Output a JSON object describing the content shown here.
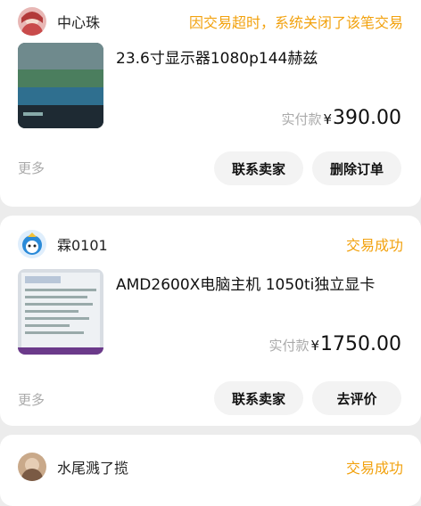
{
  "orders": [
    {
      "seller": "中心珠",
      "status": "因交易超时，系统关闭了该笔交易",
      "title": "23.6寸显示器1080p144赫兹",
      "price_label": "实付款",
      "currency": "¥",
      "price": "390.00",
      "more_label": "更多",
      "actions": [
        "联系卖家",
        "删除订单"
      ]
    },
    {
      "seller": "霖0101",
      "status": "交易成功",
      "title": "AMD2600X电脑主机 1050ti独立显卡",
      "price_label": "实付款",
      "currency": "¥",
      "price": "1750.00",
      "more_label": "更多",
      "actions": [
        "联系卖家",
        "去评价"
      ]
    },
    {
      "seller": "水尾溅了揽",
      "status": "交易成功"
    }
  ],
  "colors": {
    "status_accent": "#f2a20f",
    "muted": "#aaaaaa",
    "button_bg": "#f3f3f3"
  }
}
